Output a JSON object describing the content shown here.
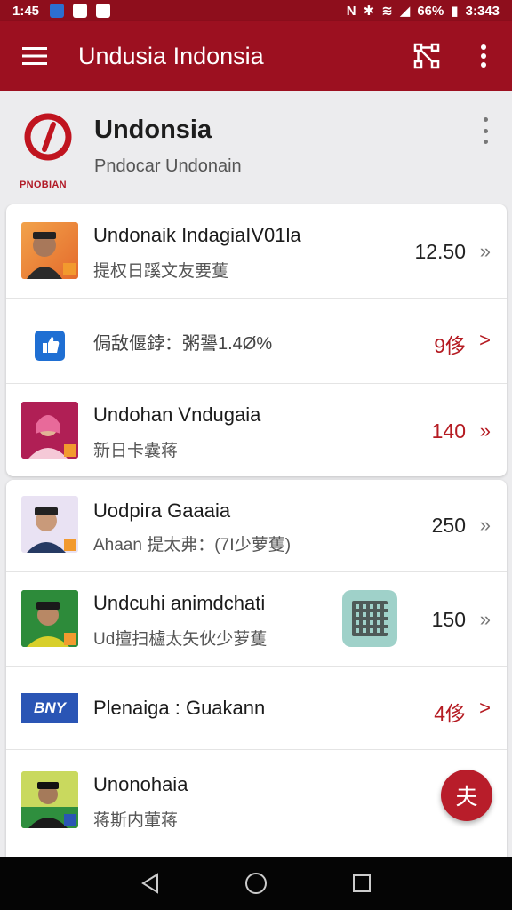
{
  "status_bar": {
    "time": "1:45",
    "battery": "66%",
    "clock": "3:343"
  },
  "appbar": {
    "title": "Undusia Indonsia"
  },
  "header": {
    "title": "Undonsia",
    "subtitle": "Pndocar  Undonain",
    "logo_text": "PNOBIAN"
  },
  "card1": {
    "rows": [
      {
        "title": "Undonaik IndagiaIV01la",
        "subtitle": "提权日蹊文友要蒦",
        "value": "12.50",
        "arrow": "»"
      },
      {
        "title": "",
        "subtitle": "",
        "text": "侷敌偃鋍：粥謽1.4Ø%",
        "value": "9侈",
        "arrow": ">"
      },
      {
        "title": "Undohan Vndugaia",
        "subtitle": "新日卡囊蒋",
        "value": "140",
        "arrow": "»"
      }
    ]
  },
  "card2": {
    "rows": [
      {
        "title": "Uodpira Gaaaia",
        "subtitle": "Ahaan 提太弗：(7Ⅰ少萝蒦)",
        "value": "250",
        "arrow": "»"
      },
      {
        "title": "Undcuhi animdchati",
        "subtitle": "Ud擅扫櫨太矢伙少萝蒦",
        "value": "150",
        "arrow": "»"
      },
      {
        "title": "Plenaiga : Guakann",
        "badge": "BNY",
        "value": "4侈",
        "arrow": ">"
      },
      {
        "title": "Unonohaia",
        "subtitle": "蒋斯内葷蒋",
        "value": "",
        "arrow": ""
      }
    ]
  },
  "fab": {
    "label": "夫"
  },
  "colors": {
    "primary": "#9c1020",
    "accent": "#b51b22"
  }
}
